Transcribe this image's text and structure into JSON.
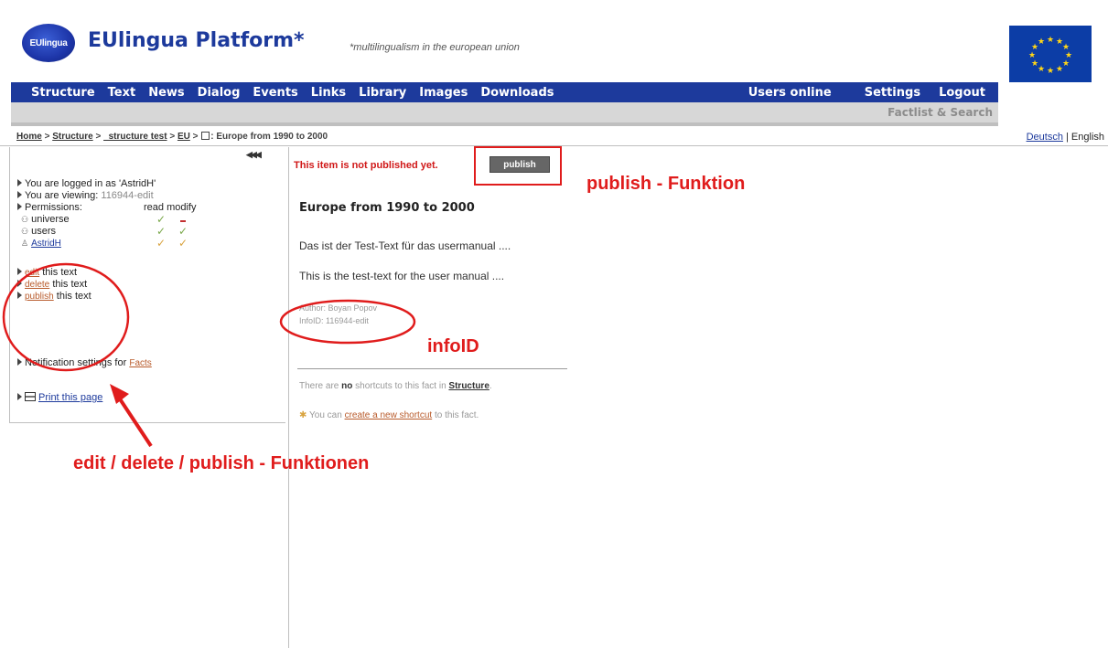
{
  "header": {
    "logo_text": "EUlingua",
    "title": "EUlingua Platform",
    "title_mark": "*",
    "tagline": "*multilingualism in the european union"
  },
  "nav": {
    "left": [
      "Structure",
      "Text",
      "News",
      "Dialog",
      "Events",
      "Links",
      "Library",
      "Images",
      "Downloads"
    ],
    "right": [
      "Users online",
      "Settings",
      "Logout"
    ],
    "sub": "Factlist & Search"
  },
  "breadcrumb": {
    "home": "Home",
    "sep": ">",
    "structure": "Structure",
    "structure_test": "_structure test",
    "eu": "EU",
    "current": ": Europe from 1990 to 2000"
  },
  "language": {
    "deutsch": "Deutsch",
    "sep": "|",
    "english": "English"
  },
  "sidebar": {
    "logged_in": "You are logged in as 'AstridH'",
    "viewing_label": "You are viewing:",
    "viewing_value": "116944-edit",
    "permissions_label": "Permissions:",
    "perm_read": "read",
    "perm_modify": "modify",
    "perm_rows": [
      "universe",
      "users",
      "AstridH"
    ],
    "edit_link": "edit",
    "edit_rest": "this text",
    "delete_link": "delete",
    "delete_rest": "this text",
    "publish_link": "publish",
    "publish_rest": "this text",
    "notification_text": "Notification settings for",
    "notification_link": "Facts",
    "print_text": "Print this page"
  },
  "main": {
    "not_published": "This item is not published yet.",
    "publish_button": "publish",
    "title": "Europe from 1990 to 2000",
    "para_de": "Das ist der Test-Text für das usermanual ....",
    "para_en": "This is the test-text for the user manual ....",
    "author": "Author: Boyan Popov",
    "info_id": "InfoID: 116944-edit",
    "shortcuts_prefix": "There are",
    "shortcuts_no": "no",
    "shortcuts_mid": "shortcuts to this fact in",
    "shortcuts_link": "Structure",
    "shortcuts_end": ".",
    "create_prefix": "You can",
    "create_link": "create a new shortcut",
    "create_suffix": "to this fact."
  },
  "annotations": {
    "publish": "publish - Funktion",
    "infoid": "infoID",
    "functions": "edit / delete / publish - Funktionen",
    "color": "#e01c1c"
  },
  "colors": {
    "nav_bg": "#1d3a9c",
    "subnav_bg": "#d7d7d7",
    "alert_red": "#d01818",
    "link_orange": "#b85a2a"
  }
}
